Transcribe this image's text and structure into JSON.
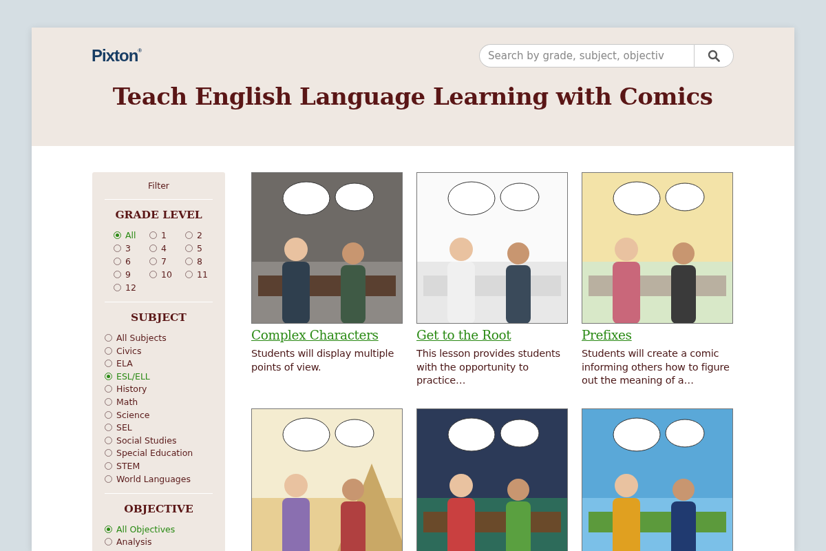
{
  "header": {
    "logo": "Pixton",
    "logo_mark": "®",
    "search": {
      "placeholder": "Search by grade, subject, objectiv"
    },
    "title": "Teach English Language Learning with Comics"
  },
  "filter": {
    "title": "Filter",
    "sections": [
      {
        "heading": "GRADE LEVEL",
        "kind": "grid",
        "options": [
          {
            "label": "All",
            "selected": true
          },
          {
            "label": "1",
            "selected": false
          },
          {
            "label": "2",
            "selected": false
          },
          {
            "label": "3",
            "selected": false
          },
          {
            "label": "4",
            "selected": false
          },
          {
            "label": "5",
            "selected": false
          },
          {
            "label": "6",
            "selected": false
          },
          {
            "label": "7",
            "selected": false
          },
          {
            "label": "8",
            "selected": false
          },
          {
            "label": "9",
            "selected": false
          },
          {
            "label": "10",
            "selected": false
          },
          {
            "label": "11",
            "selected": false
          },
          {
            "label": "12",
            "selected": false
          }
        ]
      },
      {
        "heading": "SUBJECT",
        "kind": "list",
        "options": [
          {
            "label": "All Subjects",
            "selected": false
          },
          {
            "label": "Civics",
            "selected": false
          },
          {
            "label": "ELA",
            "selected": false
          },
          {
            "label": "ESL/ELL",
            "selected": true
          },
          {
            "label": "History",
            "selected": false
          },
          {
            "label": "Math",
            "selected": false
          },
          {
            "label": "Science",
            "selected": false
          },
          {
            "label": "SEL",
            "selected": false
          },
          {
            "label": "Social Studies",
            "selected": false
          },
          {
            "label": "Special Education",
            "selected": false
          },
          {
            "label": "STEM",
            "selected": false
          },
          {
            "label": "World Languages",
            "selected": false
          }
        ]
      },
      {
        "heading": "OBJECTIVE",
        "kind": "list",
        "options": [
          {
            "label": "All Objectives",
            "selected": true
          },
          {
            "label": "Analysis",
            "selected": false
          }
        ]
      }
    ]
  },
  "lessons": [
    {
      "picture": {
        "kind": "picture"
      },
      "title": "Complex Characters",
      "description": "Students will display multiple points of view."
    },
    {
      "picture": {
        "kind": "picture"
      },
      "title": "Get to the Root",
      "description": "This lesson provides students with the opportunity to practice…"
    },
    {
      "picture": {
        "kind": "picture"
      },
      "title": "Prefixes",
      "description": "Students will create a comic informing others how to figure out the meaning of a…"
    },
    {
      "picture": {
        "kind": "picture"
      }
    },
    {
      "picture": {
        "kind": "picture"
      }
    },
    {
      "picture": {
        "kind": "picture"
      }
    }
  ]
}
